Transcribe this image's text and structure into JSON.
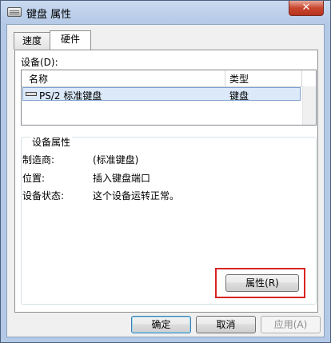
{
  "window": {
    "title": "键盘 属性",
    "close_label": "✕"
  },
  "tabs": [
    {
      "label": "速度",
      "active": false
    },
    {
      "label": "硬件",
      "active": true
    }
  ],
  "devices": {
    "label": "设备(D):",
    "columns": [
      "名称",
      "类型"
    ],
    "rows": [
      {
        "name": "PS/2 标准键盘",
        "type": "键盘",
        "selected": true
      }
    ]
  },
  "device_properties": {
    "group_label": "设备属性",
    "manufacturer_label": "制造商:",
    "manufacturer_value": "(标准键盘)",
    "location_label": "位置:",
    "location_value": "插入键盘端口",
    "status_label": "设备状态:",
    "status_value": "这个设备运转正常。",
    "properties_button": "属性(R)"
  },
  "footer": {
    "ok": "确定",
    "cancel": "取消",
    "apply": "应用(A)"
  },
  "colors": {
    "highlight": "#d9241f",
    "selection": "#dbe9f9"
  }
}
